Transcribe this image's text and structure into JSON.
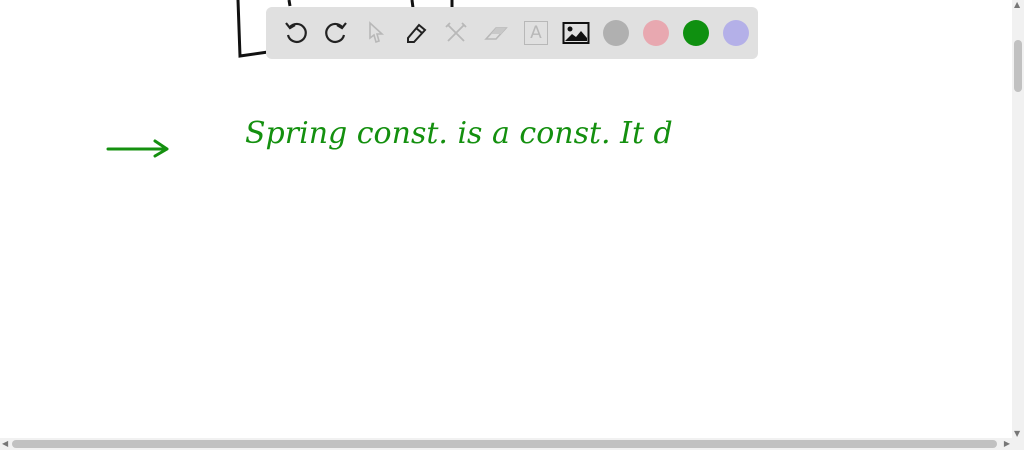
{
  "toolbar": {
    "tools": [
      {
        "name": "undo-icon",
        "enabled": true
      },
      {
        "name": "redo-icon",
        "enabled": true
      },
      {
        "name": "select-pointer-icon",
        "enabled": false
      },
      {
        "name": "pencil-icon",
        "enabled": true
      },
      {
        "name": "tools-icon",
        "enabled": false
      },
      {
        "name": "eraser-icon",
        "enabled": false
      },
      {
        "name": "text-icon",
        "enabled": false
      },
      {
        "name": "image-icon",
        "enabled": true
      }
    ],
    "colors": [
      "#b0b0b0",
      "#e8a8b0",
      "#0f9010",
      "#b4b0e8"
    ],
    "text_tool_label": "A"
  },
  "canvas": {
    "ink_color": "#14900f",
    "handwriting": "Spring const. is a const. It d"
  }
}
